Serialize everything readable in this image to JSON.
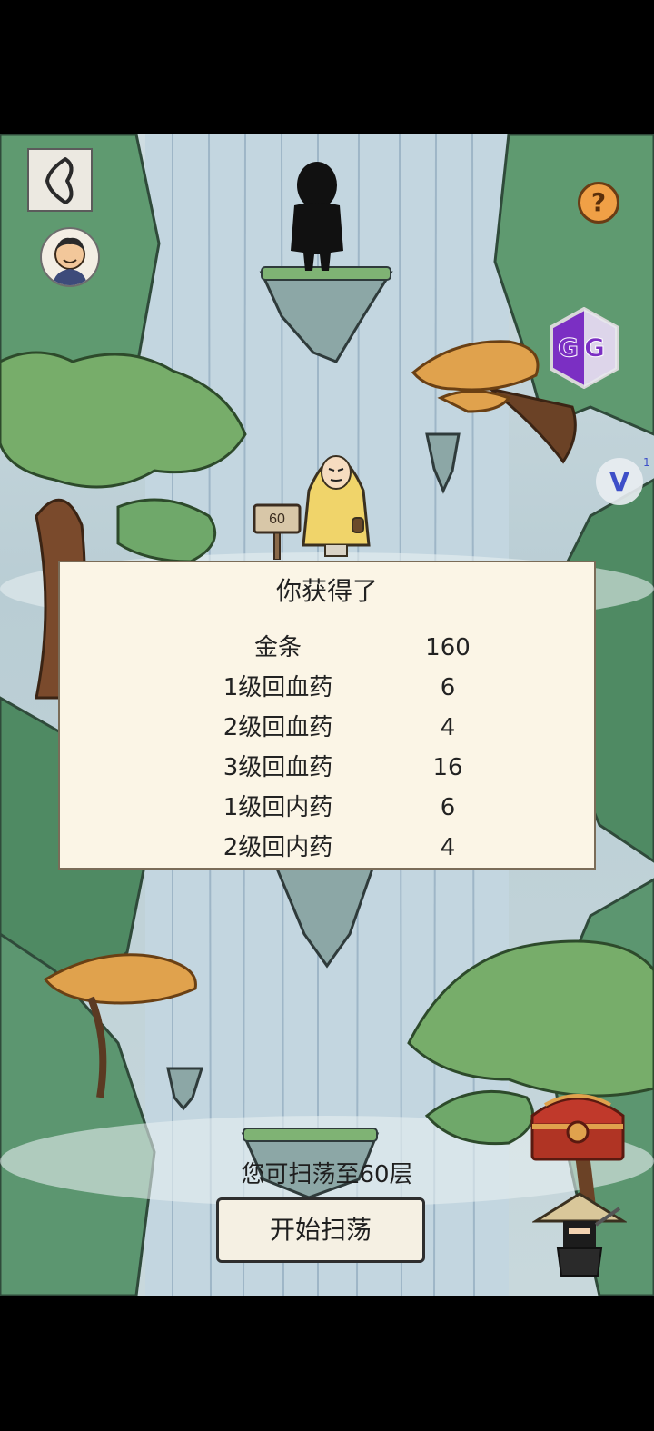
{
  "top_left": {
    "back_icon": "back-chevron-icon",
    "avatar_icon": "player-avatar-icon"
  },
  "top_right": {
    "help_label": "?",
    "gg_label": "GG",
    "v_label": "V",
    "v_count": "1"
  },
  "floor_sign": "60",
  "reward_panel": {
    "title": "你获得了",
    "items": [
      {
        "name": "金条",
        "qty": "160"
      },
      {
        "name": "1级回血药",
        "qty": "6"
      },
      {
        "name": "2级回血药",
        "qty": "4"
      },
      {
        "name": "3级回血药",
        "qty": "16"
      },
      {
        "name": "1级回内药",
        "qty": "6"
      },
      {
        "name": "2级回内药",
        "qty": "4"
      }
    ]
  },
  "sweep": {
    "note": "您可扫荡至60层",
    "button_label": "开始扫荡"
  },
  "bottom_right": {
    "chest_icon": "treasure-chest-icon",
    "ninja_icon": "straw-hat-ninja-icon"
  },
  "colors": {
    "panel_bg": "#fbf5e6",
    "help_orange": "#f0a046",
    "gg_purple": "#7b2fc3",
    "foliage": "#6fa86a",
    "autumn": "#e0a24d"
  }
}
